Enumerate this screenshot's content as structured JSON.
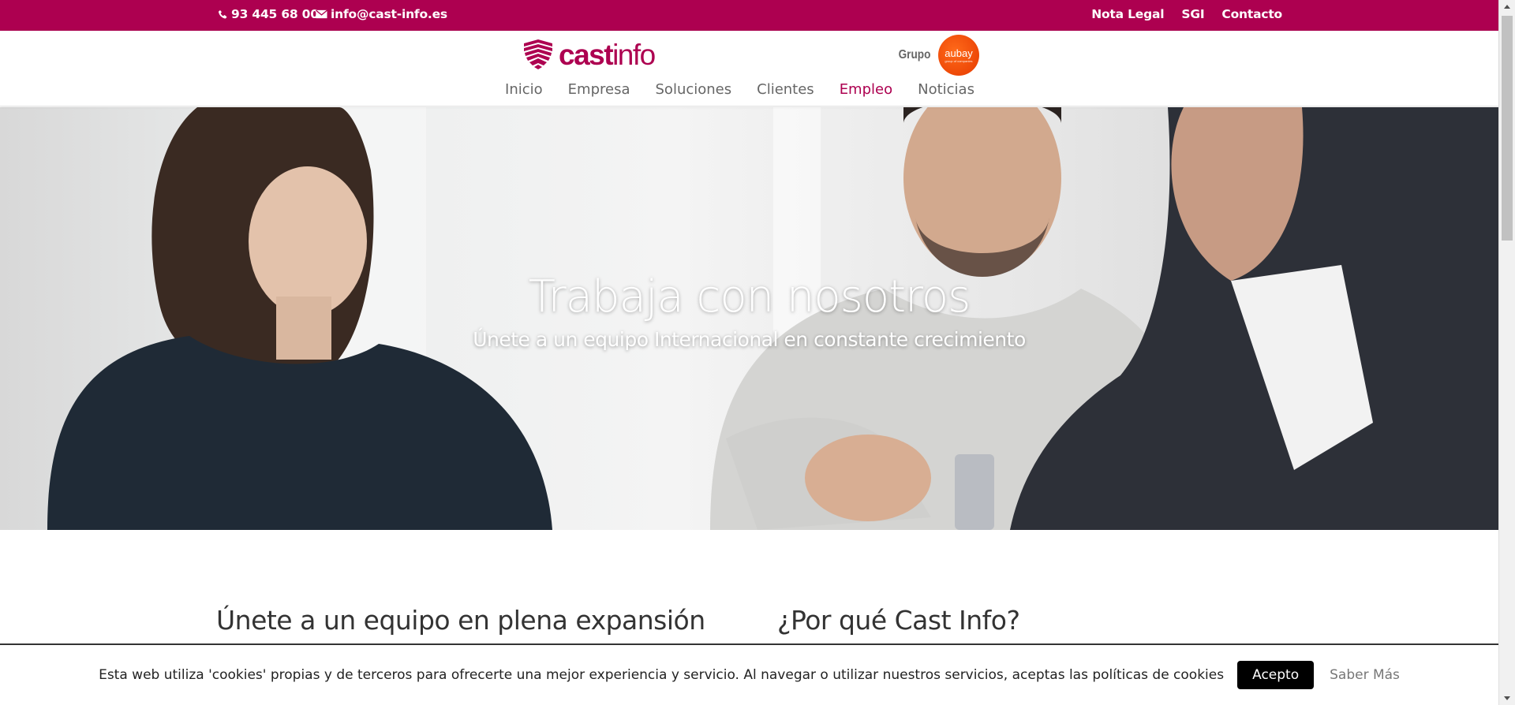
{
  "topbar": {
    "phone": "93 445 68 00",
    "email": "info@cast-info.es",
    "links": [
      "Nota Legal",
      "SGI",
      "Contacto"
    ]
  },
  "header": {
    "logo_cast": "cast",
    "logo_info": "info",
    "grupo_label": "Grupo",
    "grupo_badge": "aubay",
    "grupo_badge_tagline": "group of companies",
    "nav": [
      "Inicio",
      "Empresa",
      "Soluciones",
      "Clientes",
      "Empleo",
      "Noticias"
    ],
    "active_nav": "Empleo"
  },
  "hero": {
    "title": "Trabaja con nosotros",
    "subtitle": "Únete a un equipo Internacional en constante crecimiento"
  },
  "content": {
    "left_title": "Únete a un equipo en plena expansión",
    "right_title": "¿Por qué Cast Info?"
  },
  "cookie": {
    "text": "Esta web utiliza 'cookies' propias y de terceros para ofrecerte una mejor experiencia y servicio. Al navegar o utilizar nuestros servicios, aceptas las políticas de cookies",
    "accept": "Acepto",
    "more": "Saber Más"
  },
  "colors": {
    "brand": "#ad0050",
    "grupo_badge": "#f04a0a",
    "text": "#333333"
  }
}
